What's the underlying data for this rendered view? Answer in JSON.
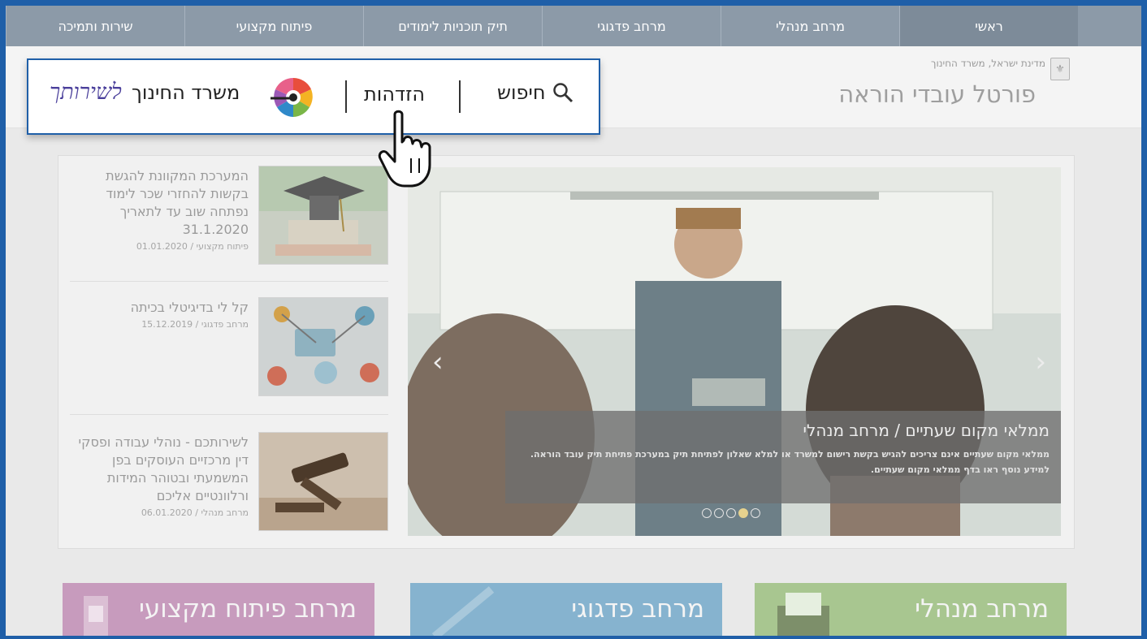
{
  "nav": {
    "items": [
      {
        "label": "ראשי",
        "active": true
      },
      {
        "label": "מרחב מנהלי"
      },
      {
        "label": "מרחב פדגוגי"
      },
      {
        "label": "תיק תוכניות לימודים"
      },
      {
        "label": "פיתוח מקצועי"
      },
      {
        "label": "שירות ותמיכה"
      }
    ]
  },
  "header": {
    "state_line": "מדינת ישראל, משרד החינוך",
    "portal_title": "פורטל עובדי הוראה"
  },
  "news": [
    {
      "title": "המערכת המקוונת להגשת בקשות להחזרי שכר לימוד נפתחה שוב עד לתאריך 31.1.2020",
      "date": "01.01.2020",
      "category": "פיתוח מקצועי"
    },
    {
      "title": "קל לי בדיגיטלי בכיתה",
      "date": "15.12.2019",
      "category": "מרחב פדגוגי"
    },
    {
      "title": "לשירותכם - נוהלי עבודה ופסקי דין מרכזיים העוסקים בפן המשמעתי ובטוהר המידות ורלוונטיים אליכם",
      "date": "06.01.2020",
      "category": "מרחב מנהלי"
    }
  ],
  "slider": {
    "title": "ממלאי מקום שעתיים / מרחב מנהלי",
    "description": "ממלאי מקום שעתיים אינם צריכים להגיש בקשת רישום למשרד או למלא שאלון לפתיחת תיק במערכת פתיחת תיק עובד הוראה. למידע נוסף ראו בדף ממלאי מקום שעתיים.",
    "dot_count": 5,
    "active_dot": 4
  },
  "tiles": [
    {
      "label": "מרחב פיתוח מקצועי",
      "color": "#c79bbd"
    },
    {
      "label": "מרחב פדגוגי",
      "color": "#86b3cf"
    },
    {
      "label": "מרחב מנהלי",
      "color": "#a8c690"
    }
  ],
  "popup": {
    "search_label": "חיפוש",
    "login_label": "הזדהות",
    "ministry_label": "משרד החינוך",
    "script_label": "לשירותך",
    "search_icon": "search-icon",
    "logo_icon": "ministry-logo-icon"
  },
  "colors": {
    "frame_border": "#1f5fa8",
    "nav_bg": "#8c9aa8",
    "script_text": "#4a3f9b"
  }
}
